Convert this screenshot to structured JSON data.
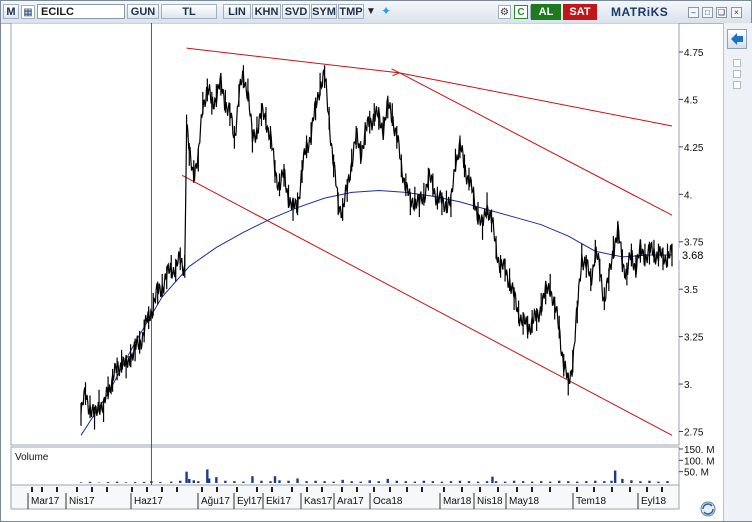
{
  "toolbar": {
    "m_label": "M",
    "symbol": "ECILC",
    "period_label": "GUN",
    "currency_label": "TL",
    "scale_buttons": [
      "LIN",
      "KHN",
      "SVD",
      "SYM",
      "TMP"
    ],
    "buy_label": "AL",
    "sell_label": "SAT",
    "brand": "MATRiKS"
  },
  "colors": {
    "price": "#000000",
    "moving_average": "#1b2fa0",
    "trendline": "#cc1111",
    "volume": "#1a3a8a",
    "buy": "#1e7a1e",
    "sell": "#c01818"
  },
  "chart_data": [
    {
      "type": "line",
      "title": "",
      "y_ticks": [
        "4.75",
        "4.5",
        "4.25",
        "4.",
        "3.75",
        "3.5",
        "3.25",
        "3.",
        "2.75"
      ],
      "last_value_label": "3.68",
      "ylim": [
        2.7,
        4.85
      ],
      "x_tick_labels": [
        "Mar17",
        "Nis17",
        "Haz17",
        "Ağu17",
        "Eyl17",
        "Eki17",
        "Kas17",
        "Ara17",
        "Oca18",
        "Mar18",
        "Nis18",
        "May18",
        "Tem18",
        "Eyl18"
      ],
      "series": [
        {
          "style": "bars",
          "x": [
            0,
            5,
            10,
            15,
            20,
            25,
            30,
            35,
            40,
            45,
            50,
            55,
            60,
            65,
            70,
            75,
            80,
            85,
            90,
            95,
            100,
            105,
            110,
            115,
            117,
            120,
            125,
            130,
            135,
            140,
            145,
            150,
            155,
            160,
            165,
            170,
            175,
            180,
            185,
            190,
            195,
            200,
            205,
            210,
            215,
            220,
            225,
            230,
            235,
            240,
            245,
            250,
            255,
            260,
            265,
            270,
            275,
            280,
            285,
            290,
            295,
            300,
            305,
            310,
            315,
            320,
            325,
            330,
            335,
            340,
            345,
            350,
            355,
            360,
            365,
            370,
            375,
            380,
            385,
            390,
            395,
            400,
            405,
            410,
            415,
            420,
            425,
            430,
            435,
            440,
            445,
            450,
            455,
            460,
            465,
            470,
            475,
            480,
            485,
            490,
            495,
            500,
            505,
            510,
            515,
            520,
            525,
            530,
            535,
            540,
            545,
            550,
            555,
            560,
            565,
            570,
            575,
            580,
            585,
            590,
            595,
            600,
            605,
            610,
            615,
            620,
            625,
            630,
            635,
            640,
            645,
            650,
            655
          ],
          "values": [
            2.84,
            2.95,
            2.88,
            2.82,
            2.91,
            2.86,
            2.98,
            3.02,
            3.08,
            3.12,
            3.09,
            3.15,
            3.18,
            3.22,
            3.28,
            3.35,
            3.42,
            3.48,
            3.52,
            3.56,
            3.62,
            3.6,
            3.66,
            3.62,
            4.36,
            4.21,
            4.12,
            4.18,
            4.48,
            4.55,
            4.48,
            4.52,
            4.58,
            4.49,
            4.42,
            4.3,
            4.52,
            4.62,
            4.55,
            4.28,
            4.35,
            4.42,
            4.4,
            4.3,
            4.12,
            4.05,
            4.1,
            3.99,
            3.92,
            3.95,
            4.12,
            4.25,
            4.32,
            4.45,
            4.58,
            4.62,
            4.4,
            4.15,
            3.95,
            3.92,
            4.02,
            4.18,
            4.3,
            4.22,
            4.32,
            4.38,
            4.42,
            4.4,
            4.35,
            4.46,
            4.42,
            4.3,
            4.15,
            4.05,
            3.95,
            3.98,
            3.94,
            4.0,
            4.08,
            4.05,
            3.98,
            3.95,
            3.96,
            3.94,
            4.18,
            4.25,
            4.15,
            4.08,
            3.98,
            3.9,
            3.82,
            3.95,
            3.86,
            3.72,
            3.62,
            3.6,
            3.55,
            3.45,
            3.38,
            3.32,
            3.3,
            3.33,
            3.34,
            3.42,
            3.48,
            3.52,
            3.4,
            3.3,
            3.1,
            3.0,
            3.12,
            3.38,
            3.68,
            3.62,
            3.55,
            3.7,
            3.6,
            3.45,
            3.55,
            3.72,
            3.8,
            3.65,
            3.58,
            3.68,
            3.62,
            3.7,
            3.68,
            3.69,
            3.7,
            3.68,
            3.66,
            3.68,
            3.68
          ]
        },
        {
          "name": "moving-average",
          "style": "line",
          "x": [
            0,
            30,
            60,
            90,
            120,
            150,
            180,
            210,
            240,
            270,
            300,
            330,
            360,
            390,
            420,
            450,
            480,
            510,
            540,
            570,
            600,
            630,
            655
          ],
          "values": [
            2.73,
            2.95,
            3.22,
            3.46,
            3.62,
            3.72,
            3.8,
            3.87,
            3.93,
            3.98,
            4.01,
            4.02,
            4.01,
            3.99,
            3.96,
            3.92,
            3.88,
            3.84,
            3.78,
            3.7,
            3.67,
            3.68,
            3.68
          ]
        }
      ],
      "trendlines": [
        {
          "x": [
            117,
            353
          ],
          "values": [
            4.77,
            4.64
          ]
        },
        {
          "x": [
            353,
            655
          ],
          "values": [
            4.64,
            4.36
          ]
        },
        {
          "x": [
            353,
            655
          ],
          "values": [
            4.64,
            3.89
          ]
        },
        {
          "x": [
            112,
            655
          ],
          "values": [
            4.1,
            2.73
          ]
        }
      ],
      "pivot_x": 78
    },
    {
      "type": "bar",
      "ylabel": "Volume",
      "y_ticks": [
        "150. M",
        "100. M",
        "50. M"
      ],
      "ylim": [
        0,
        150
      ],
      "x": [
        0,
        10,
        20,
        30,
        40,
        50,
        60,
        70,
        78,
        88,
        100,
        110,
        117,
        120,
        125,
        130,
        140,
        142,
        150,
        160,
        170,
        180,
        190,
        200,
        210,
        215,
        220,
        230,
        240,
        250,
        260,
        270,
        280,
        290,
        300,
        310,
        320,
        330,
        340,
        350,
        360,
        370,
        380,
        390,
        400,
        410,
        420,
        430,
        440,
        450,
        456,
        460,
        470,
        480,
        490,
        500,
        510,
        520,
        530,
        540,
        550,
        560,
        570,
        580,
        588,
        592,
        600,
        610,
        620,
        630,
        640,
        650
      ],
      "values": [
        3,
        5,
        2,
        4,
        6,
        3,
        4,
        5,
        8,
        4,
        6,
        10,
        50,
        18,
        12,
        8,
        60,
        20,
        26,
        10,
        8,
        6,
        30,
        10,
        8,
        30,
        12,
        10,
        20,
        8,
        10,
        8,
        6,
        14,
        8,
        6,
        12,
        8,
        18,
        10,
        8,
        6,
        10,
        8,
        6,
        8,
        10,
        8,
        6,
        8,
        28,
        8,
        6,
        10,
        8,
        6,
        8,
        6,
        10,
        8,
        6,
        8,
        10,
        8,
        10,
        55,
        18,
        12,
        8,
        10,
        6,
        8
      ]
    }
  ]
}
